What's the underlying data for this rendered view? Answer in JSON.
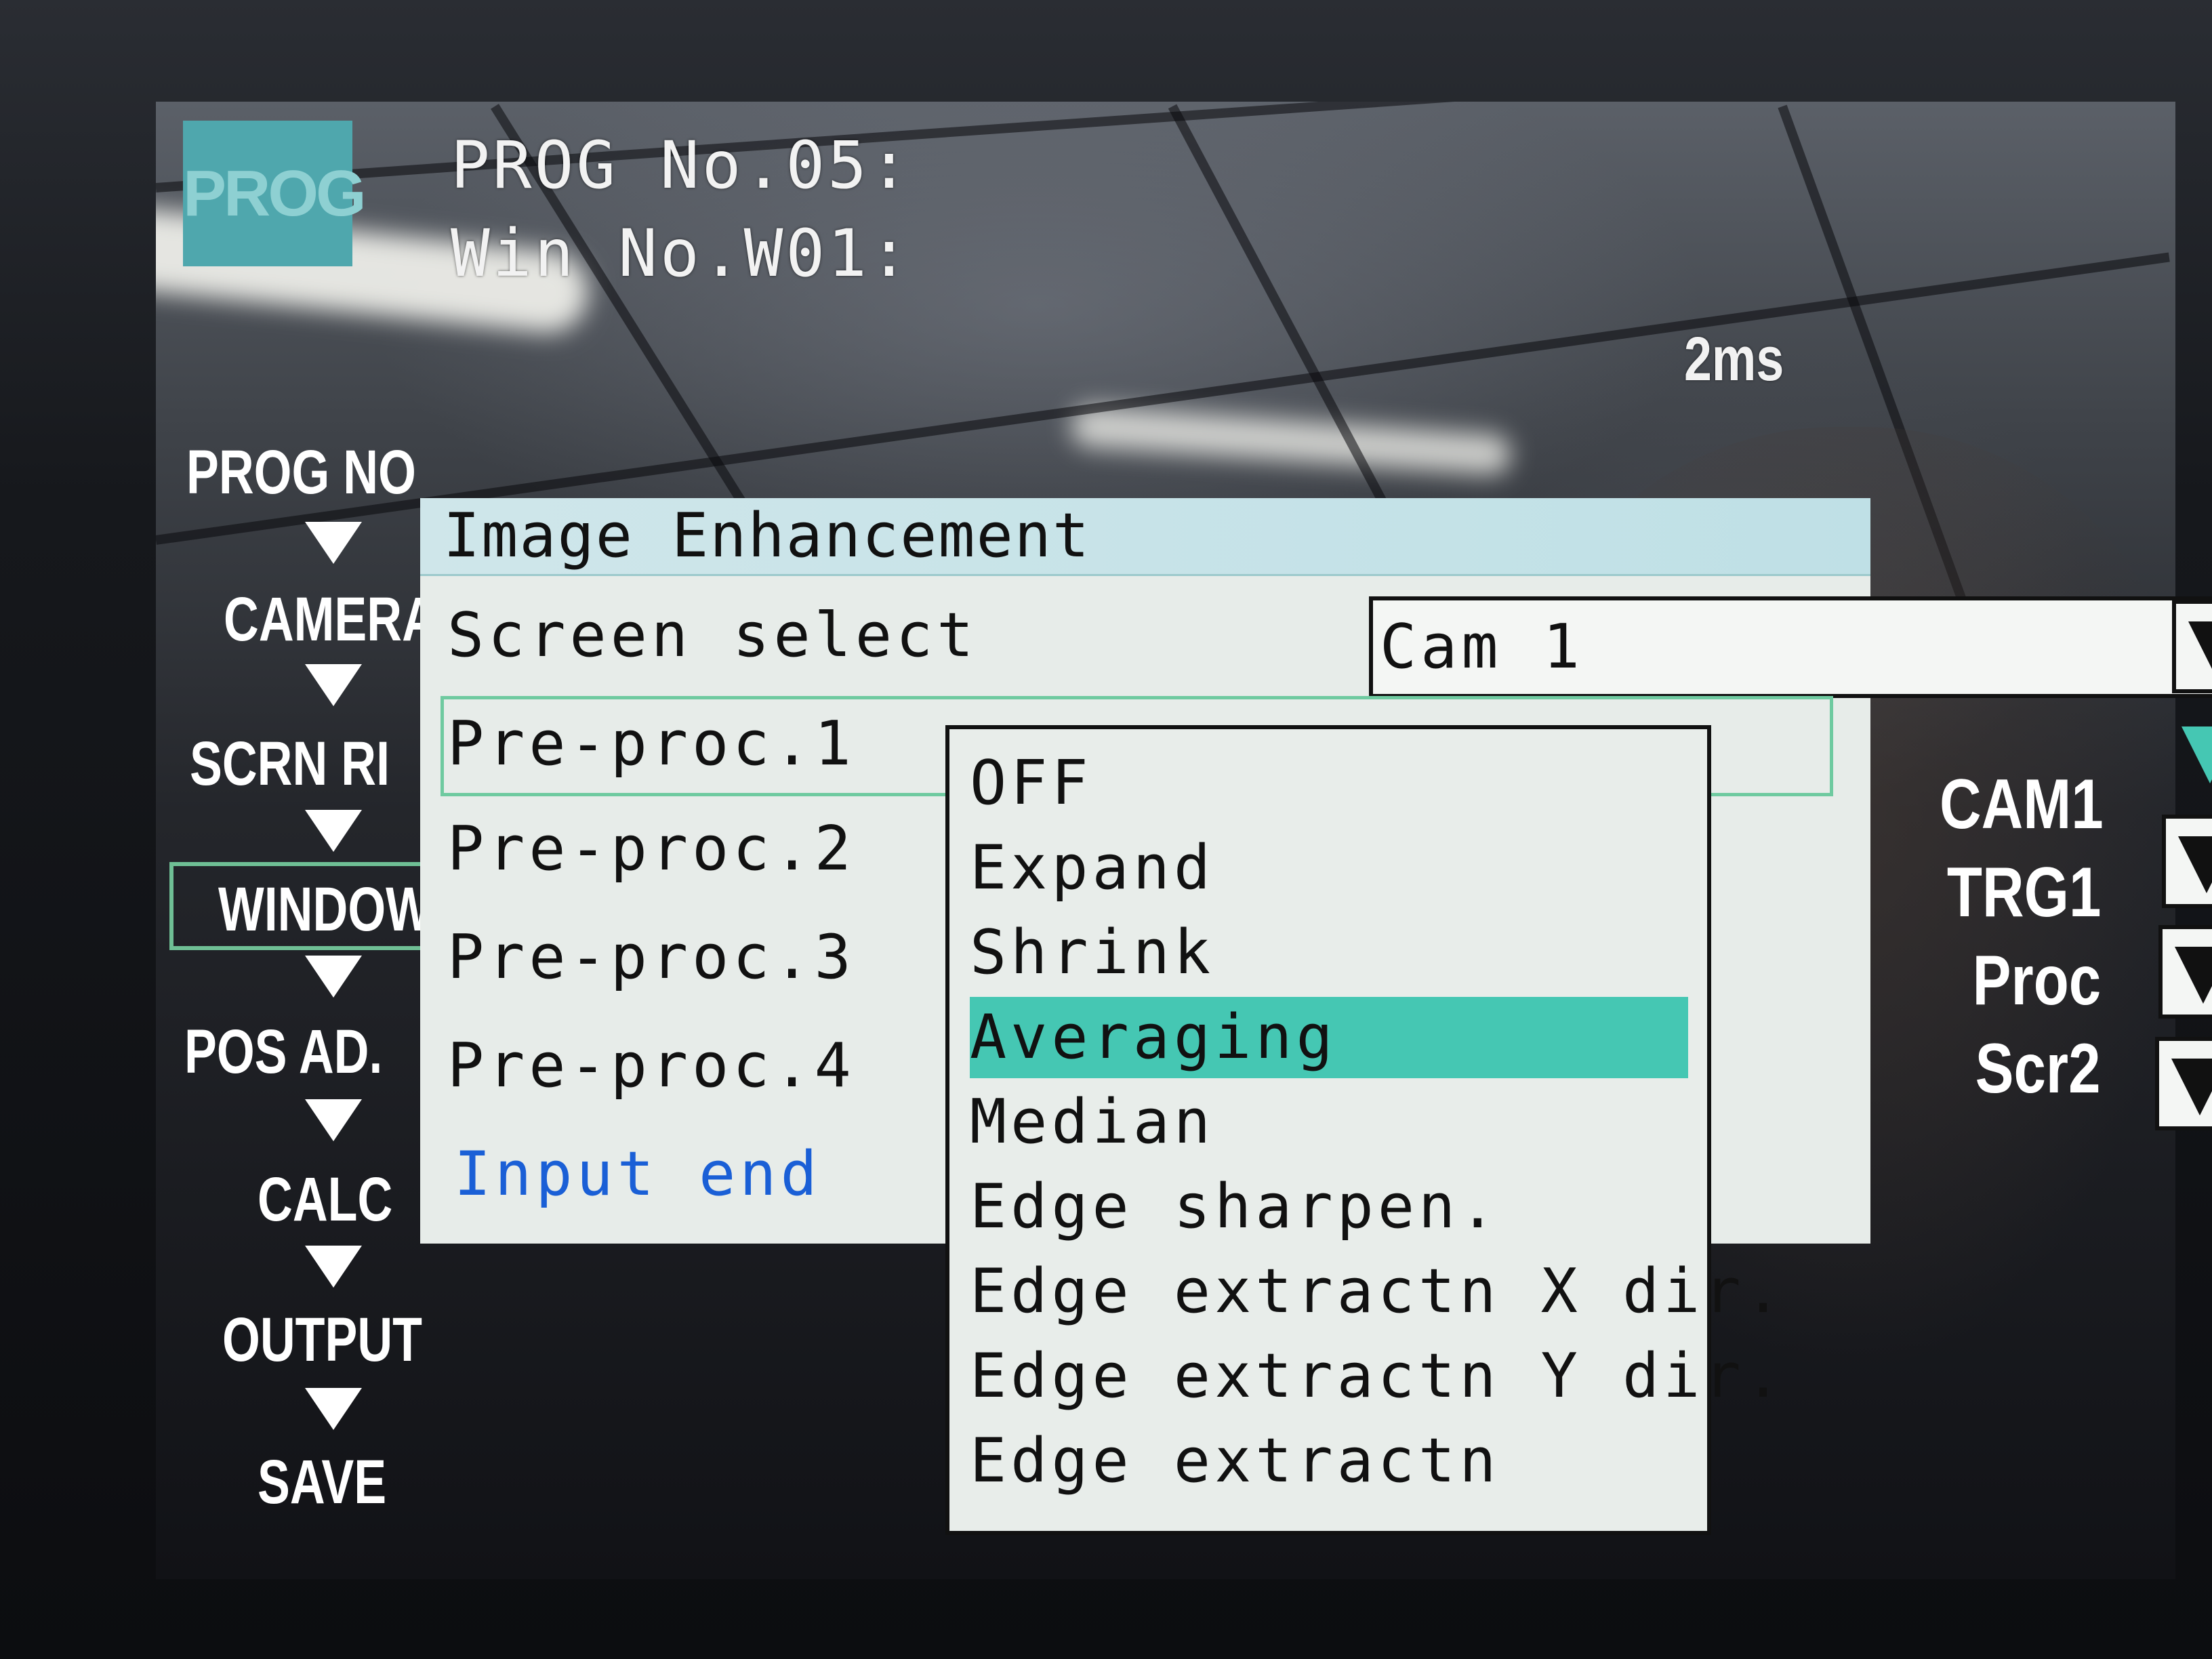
{
  "header": {
    "badge": "PROG",
    "prog_line": "PROG No.05:",
    "win_line": "Win No.W01:",
    "timing": "2ms"
  },
  "flow": {
    "items": [
      "PROG NO",
      "CAMERA",
      "SCRN RI",
      "WINDOW",
      "POS AD.",
      "CALC",
      "OUTPUT",
      "SAVE"
    ]
  },
  "status": {
    "lines": [
      "CAM1",
      "TRG1",
      "Proc",
      "Scr2"
    ]
  },
  "dialog": {
    "title": "Image Enhancement",
    "screen_select_label": "Screen select",
    "screen_select_value": "Cam 1",
    "rows": [
      "Pre-proc.1",
      "Pre-proc.2",
      "Pre-proc.3",
      "Pre-proc.4"
    ],
    "input_end": "Input end"
  },
  "dropdown": {
    "options": [
      "OFF",
      "Expand",
      "Shrink",
      "Averaging",
      "Median",
      "Edge sharpen.",
      "Edge extractn X dir.",
      "Edge extractn Y dir.",
      "Edge extractn"
    ],
    "selected": "Averaging"
  },
  "colors": {
    "highlight": "#45c7b3",
    "badge": "#4fa7ad",
    "dialog_bg": "#e7ece9",
    "title_bar": "#c6e3e8",
    "input_end_text": "#1a5fd6"
  },
  "icons": {
    "flow_arrow": "down-triangle-icon",
    "dropdown": "dropdown-arrow-icon"
  }
}
